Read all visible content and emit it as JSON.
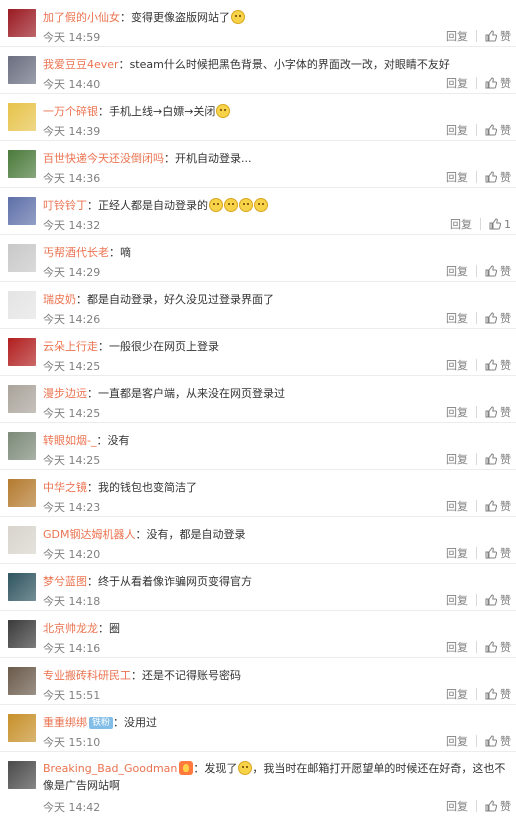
{
  "reply_label": "回复",
  "like_label": "赞",
  "comments": [
    {
      "user": "加了假的小仙女",
      "text": "变得更像盗版网站了",
      "emoji_count": 1,
      "time": "今天 14:59",
      "likes": "",
      "avatar_color": "#9a1a22"
    },
    {
      "user": "我爱豆豆4ever",
      "text": "steam什么时候把黑色背景、小字体的界面改一改，对眼睛不友好",
      "emoji_count": 0,
      "time": "今天 14:40",
      "likes": "",
      "avatar_color": "#6a6e80"
    },
    {
      "user": "一万个碎银",
      "text": "手机上线→白嫖→关闭",
      "emoji_count": 1,
      "time": "今天 14:39",
      "likes": "",
      "avatar_color": "#e7c34a"
    },
    {
      "user": "百世快递今天还没倒闭吗",
      "text": "开机自动登录...",
      "emoji_count": 0,
      "time": "今天 14:36",
      "likes": "",
      "avatar_color": "#4a7a3a"
    },
    {
      "user": "叮铃铃丁",
      "text": "正经人都是自动登录的",
      "emoji_count": 4,
      "time": "今天 14:32",
      "likes": "1",
      "avatar_color": "#5d6fa8"
    },
    {
      "user": "丐帮酒代长老",
      "text": "嘀",
      "emoji_count": 0,
      "time": "今天 14:29",
      "likes": "",
      "avatar_color": "#c8c8c8"
    },
    {
      "user": "瑞皮奶",
      "text": "都是自动登录，好久没见过登录界面了",
      "emoji_count": 0,
      "time": "今天 14:26",
      "likes": "",
      "avatar_color": "#e4e4e4"
    },
    {
      "user": "云朵上行走",
      "text": "一般很少在网页上登录",
      "emoji_count": 0,
      "time": "今天 14:25",
      "likes": "",
      "avatar_color": "#b11e1e"
    },
    {
      "user": "漫步边远",
      "text": "一直都是客户端，从来没在网页登录过",
      "emoji_count": 0,
      "time": "今天 14:25",
      "likes": "",
      "avatar_color": "#a9a39a"
    },
    {
      "user": "转眼如烟-_",
      "text": "没有",
      "emoji_count": 0,
      "time": "今天 14:25",
      "likes": "",
      "avatar_color": "#7c8a78"
    },
    {
      "user": "中华之镜",
      "text": "我的钱包也变简洁了",
      "emoji_count": 0,
      "time": "今天 14:23",
      "likes": "",
      "avatar_color": "#b47a2e"
    },
    {
      "user": "GDM钢达姆机器人",
      "text": "没有，都是自动登录",
      "emoji_count": 0,
      "time": "今天 14:20",
      "likes": "",
      "avatar_color": "#d8d4cc"
    },
    {
      "user": "梦兮蓝图",
      "text": "终于从看着像诈骗网页变得官方",
      "emoji_count": 0,
      "time": "今天 14:18",
      "likes": "",
      "avatar_color": "#2f5560"
    },
    {
      "user": "北京帅龙龙",
      "text": "圈",
      "emoji_count": 0,
      "time": "今天 14:16",
      "likes": "",
      "avatar_color": "#3a3a3a"
    },
    {
      "user": "专业搬砖科研民工",
      "text": "还是不记得账号密码",
      "emoji_count": 0,
      "time": "今天 15:51",
      "likes": "",
      "avatar_color": "#6a5a4a"
    },
    {
      "user": "重重绑绑",
      "badge": "铁粉",
      "text": "没用过",
      "emoji_count": 0,
      "time": "今天 15:10",
      "likes": "",
      "avatar_color": "#c7902a"
    },
    {
      "user": "Breaking_Bad_Goodman",
      "flame": true,
      "text_before": "发现了",
      "text": "，我当时在邮箱打开愿望单的时候还在好奇，这也不像是广告网站啊",
      "emoji_count": 1,
      "time": "今天 14:42",
      "likes": "",
      "avatar_color": "#4a4a4a"
    }
  ]
}
